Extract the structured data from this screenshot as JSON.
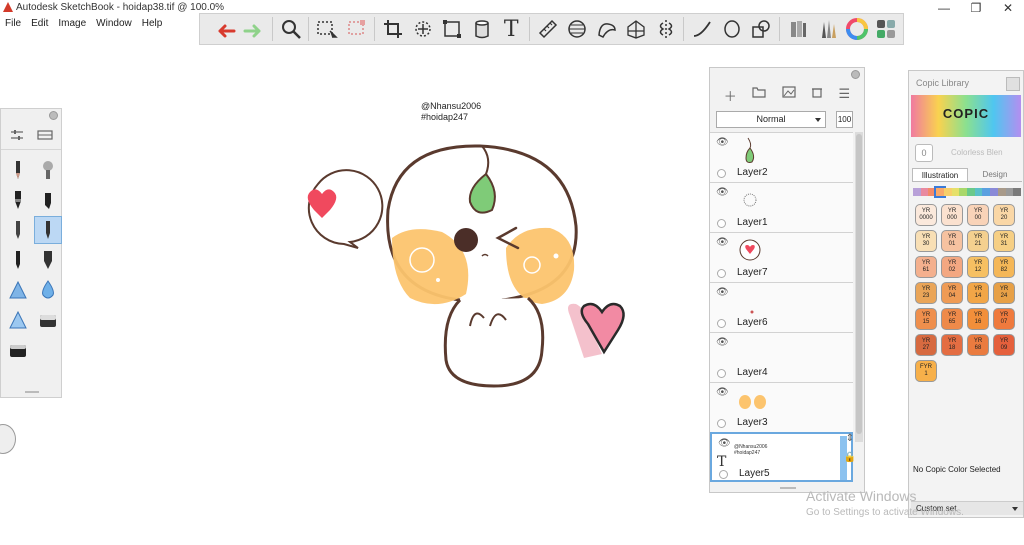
{
  "window": {
    "title": "Autodesk SketchBook - hoidap38.tif @ 100.0%",
    "controls": [
      "—",
      "❐",
      "✕"
    ]
  },
  "menu": [
    "File",
    "Edit",
    "Image",
    "Window",
    "Help"
  ],
  "canvas": {
    "signature_line1": "@Nhansu2006",
    "signature_line2": "#hoidap247"
  },
  "layers_panel": {
    "blend_mode": "Normal",
    "opacity": "100",
    "layers": [
      {
        "name": "Layer2"
      },
      {
        "name": "Layer1"
      },
      {
        "name": "Layer7"
      },
      {
        "name": "Layer6"
      },
      {
        "name": "Layer4"
      },
      {
        "name": "Layer3"
      },
      {
        "name": "Layer5",
        "thumb_line1": "@Nhansu2006",
        "thumb_line2": "#hoidap247"
      }
    ]
  },
  "copic": {
    "title": "Copic Library",
    "logo": "COPIC",
    "colorless_label": "Colorless Blen",
    "colorless_value": "0",
    "tabs": [
      "Illustration",
      "Design"
    ],
    "swatches": [
      {
        "code": "YR",
        "num": "0000",
        "color": "#fbe9dc"
      },
      {
        "code": "YR",
        "num": "000",
        "color": "#fbe1cf"
      },
      {
        "code": "YR",
        "num": "00",
        "color": "#f9d3b8"
      },
      {
        "code": "YR",
        "num": "20",
        "color": "#fad7a6"
      },
      {
        "code": "YR",
        "num": "30",
        "color": "#f8dfb5"
      },
      {
        "code": "YR",
        "num": "01",
        "color": "#f6c2a0"
      },
      {
        "code": "YR",
        "num": "21",
        "color": "#f4d08f"
      },
      {
        "code": "YR",
        "num": "31",
        "color": "#f6cf84"
      },
      {
        "code": "YR",
        "num": "61",
        "color": "#f4b08e"
      },
      {
        "code": "YR",
        "num": "02",
        "color": "#f3a781"
      },
      {
        "code": "YR",
        "num": "12",
        "color": "#f6c062"
      },
      {
        "code": "YR",
        "num": "82",
        "color": "#f5b757"
      },
      {
        "code": "YR",
        "num": "23",
        "color": "#eaa558"
      },
      {
        "code": "YR",
        "num": "04",
        "color": "#ef9b55"
      },
      {
        "code": "YR",
        "num": "14",
        "color": "#f2a647"
      },
      {
        "code": "YR",
        "num": "24",
        "color": "#e7a046"
      },
      {
        "code": "YR",
        "num": "15",
        "color": "#ef8f4d"
      },
      {
        "code": "YR",
        "num": "65",
        "color": "#ee8a4a"
      },
      {
        "code": "YR",
        "num": "16",
        "color": "#f28f3a"
      },
      {
        "code": "YR",
        "num": "07",
        "color": "#ef7a3d"
      },
      {
        "code": "YR",
        "num": "27",
        "color": "#d76a40"
      },
      {
        "code": "YR",
        "num": "18",
        "color": "#e46d42"
      },
      {
        "code": "YR",
        "num": "68",
        "color": "#ea7b3f"
      },
      {
        "code": "YR",
        "num": "09",
        "color": "#e5603c"
      },
      {
        "code": "FYR",
        "num": "1",
        "color": "#f7b04a"
      }
    ],
    "status": "No Copic Color Selected",
    "set_label": "Custom set"
  },
  "watermark": {
    "line1": "Activate Windows",
    "line2": "Go to Settings to activate Windows."
  }
}
